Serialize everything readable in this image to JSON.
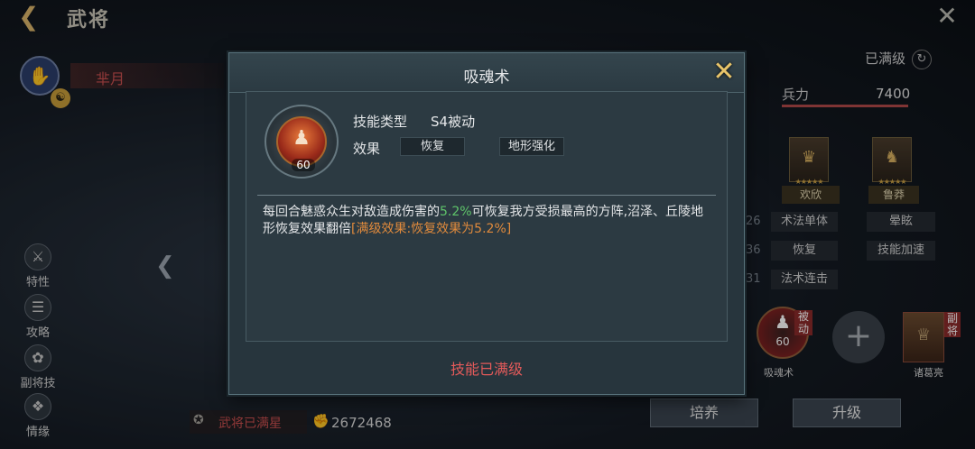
{
  "header": {
    "title": "武将"
  },
  "hero": {
    "name": "芈月"
  },
  "sidebar": {
    "items": [
      {
        "label": "特性"
      },
      {
        "label": "攻略"
      },
      {
        "label": "副将技"
      },
      {
        "label": "情缘"
      }
    ]
  },
  "right_panel": {
    "level_status": "已满级",
    "force_label": "兵力",
    "force_value": "7400",
    "cards": [
      {
        "label": "欢欣"
      },
      {
        "label": "鲁莽"
      }
    ],
    "stats": {
      "rows": [
        {
          "num": "26",
          "a": "术法单体",
          "b": "晕眩"
        },
        {
          "num": "36",
          "a": "恢复",
          "b": "技能加速"
        },
        {
          "num": "31",
          "a": "法术连击"
        }
      ]
    },
    "skill_slot": {
      "tag": "被动",
      "level": "60",
      "name": "吸魂术"
    },
    "vice_general": {
      "tag": "副将",
      "name": "诸葛亮"
    }
  },
  "bottom": {
    "cultivate_label": "培养",
    "upgrade_label": "升级",
    "star_status": "武将已满星",
    "power_value": "2672468"
  },
  "modal": {
    "title": "吸魂术",
    "skill_level": "60",
    "type_label": "技能类型",
    "type_value": "S4被动",
    "effect_label": "效果",
    "effect_tags": [
      "恢复",
      "地形强化"
    ],
    "description": {
      "part1": "每回合魅惑众生对敌造成伤害的",
      "highlight_pct": "5.2%",
      "part2": "可恢复我方受损最高的方阵,沼泽、丘陵地形恢复效果翻倍",
      "full_effect": "[满级效果:恢复效果为5.2%]"
    },
    "max_level_text": "技能已满级"
  },
  "colors": {
    "accent_gold": "#e8c46a",
    "max_red": "#e35a5a",
    "highlight_green": "#5fc46a",
    "highlight_orange": "#e08a3c"
  }
}
